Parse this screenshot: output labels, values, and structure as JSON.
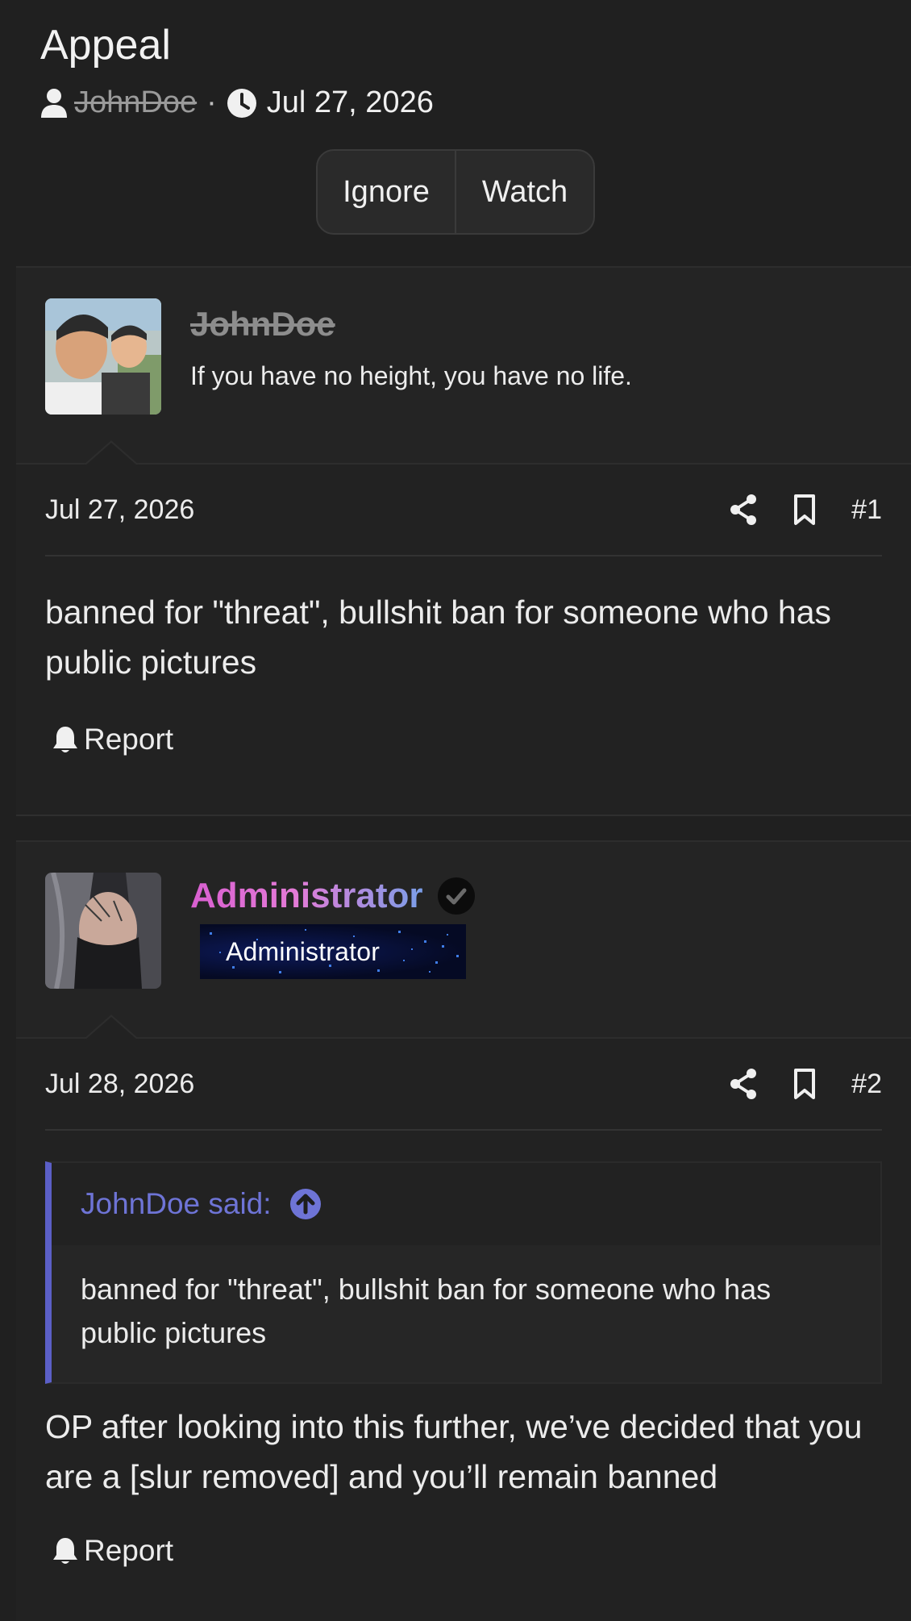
{
  "thread": {
    "title": "Appeal",
    "author": "JohnDoe",
    "separator": "·",
    "date": "Jul 27, 2026",
    "buttons": {
      "ignore": "Ignore",
      "watch": "Watch"
    }
  },
  "posts": [
    {
      "username": "JohnDoe",
      "user_title": "If you have no height, you have no life.",
      "date": "Jul 27, 2026",
      "number": "#1",
      "body": "banned for \"threat\", bullshit ban for someone who has public pictures",
      "report_label": "Report"
    },
    {
      "username": "Administrator",
      "banner_label": "Administrator",
      "date": "Jul 28, 2026",
      "number": "#2",
      "quote": {
        "header": "JohnDoe said:",
        "body": "banned for \"threat\", bullshit ban for someone who has public pictures"
      },
      "body": "OP after looking into this further, we’ve decided that you are a [slur removed] and you’ll remain banned",
      "report_label": "Report"
    }
  ],
  "colors": {
    "background": "#202020",
    "quote_accent": "#5b5fc7",
    "admin_gradient_start": "#d85fd0",
    "admin_gradient_end": "#7a9ee8"
  },
  "icons": [
    "user-icon",
    "clock-icon",
    "share-icon",
    "bookmark-icon",
    "bell-icon",
    "verified-check-icon",
    "arrow-up-circle-icon"
  ]
}
